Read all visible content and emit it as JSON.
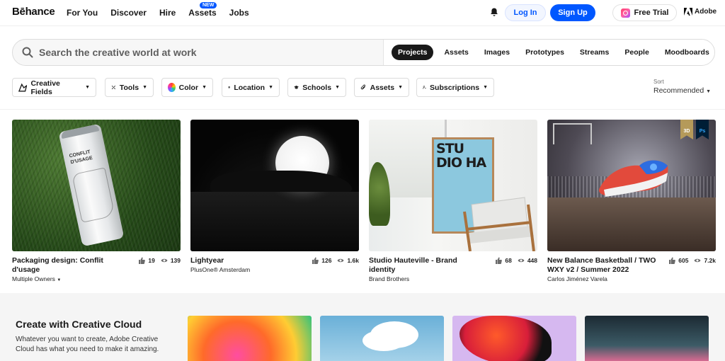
{
  "nav": {
    "logo": "Bēhance",
    "links": [
      "For You",
      "Discover",
      "Hire",
      "Assets",
      "Jobs"
    ],
    "assets_badge": "NEW",
    "login": "Log In",
    "signup": "Sign Up",
    "free_trial": "Free Trial",
    "adobe": "Adobe"
  },
  "search": {
    "placeholder": "Search the creative world at work",
    "tabs": [
      "Projects",
      "Assets",
      "Images",
      "Prototypes",
      "Streams",
      "People",
      "Moodboards"
    ],
    "active_tab": "Projects"
  },
  "filters": [
    "Creative Fields",
    "Tools",
    "Color",
    "Location",
    "Schools",
    "Assets",
    "Subscriptions"
  ],
  "sort": {
    "label": "Sort",
    "value": "Recommended"
  },
  "projects": [
    {
      "title": "Packaging design: Conflit d'usage",
      "owner": "Multiple Owners",
      "likes": "19",
      "views": "139",
      "can_text": "CONFLIT D'USAGE"
    },
    {
      "title": "Lightyear",
      "owner": "PlusOne® Amsterdam",
      "likes": "126",
      "views": "1.6k"
    },
    {
      "title": "Studio Hauteville - Brand identity",
      "owner": "Brand Brothers",
      "likes": "68",
      "views": "448",
      "poster_text": "STU DIO HA"
    },
    {
      "title": "New Balance Basketball / TWO WXY v2 / Summer 2022",
      "owner": "Carlos Jiménez Varela",
      "likes": "605",
      "views": "7.2k",
      "badges": [
        "3D",
        "Ps"
      ]
    }
  ],
  "creative_cloud": {
    "title": "Create with Creative Cloud",
    "text": "Whatever you want to create, Adobe Creative Cloud has what you need to make it amazing."
  },
  "colors": {
    "brand_blue": "#0057ff",
    "dark": "#191919",
    "badge_3d": "#b59a5a",
    "badge_ps": "#001e36"
  }
}
